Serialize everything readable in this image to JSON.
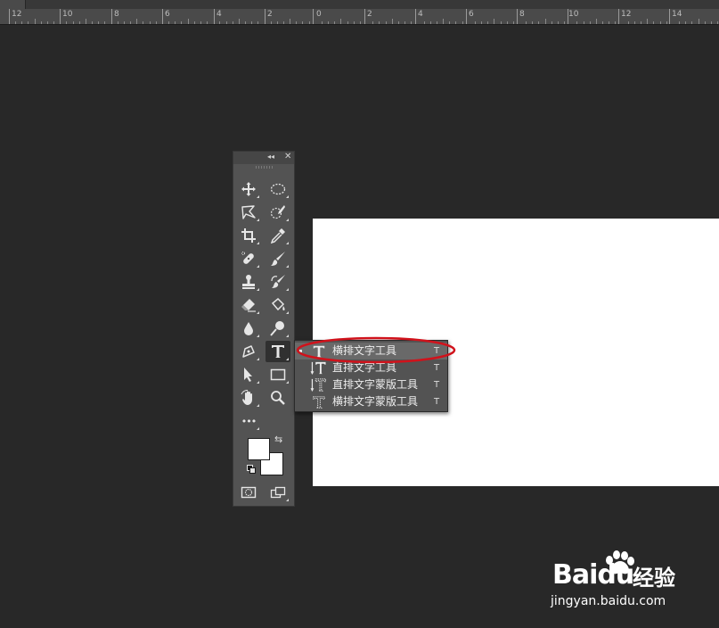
{
  "ruler": {
    "labels": [
      "12",
      "10",
      "8",
      "6",
      "4",
      "2",
      "0",
      "2",
      "4",
      "6",
      "8",
      "10",
      "12",
      "14"
    ]
  },
  "toolbar": {
    "collapse_glyph": "◂◂",
    "close_glyph": "✕",
    "tools": [
      {
        "name": "move-tool",
        "icon": "move-icon"
      },
      {
        "name": "elliptical-marquee-tool",
        "icon": "ellipse-marquee-icon"
      },
      {
        "name": "polygonal-lasso-tool",
        "icon": "lasso-icon"
      },
      {
        "name": "quick-selection-tool",
        "icon": "quick-select-icon"
      },
      {
        "name": "crop-tool",
        "icon": "crop-icon"
      },
      {
        "name": "eyedropper-tool",
        "icon": "eyedropper-icon"
      },
      {
        "name": "spot-healing-tool",
        "icon": "bandage-icon"
      },
      {
        "name": "brush-tool",
        "icon": "brush-icon"
      },
      {
        "name": "clone-stamp-tool",
        "icon": "stamp-icon"
      },
      {
        "name": "history-brush-tool",
        "icon": "history-brush-icon"
      },
      {
        "name": "eraser-tool",
        "icon": "eraser-icon"
      },
      {
        "name": "paint-bucket-tool",
        "icon": "bucket-icon"
      },
      {
        "name": "blur-tool",
        "icon": "drop-icon"
      },
      {
        "name": "dodge-tool",
        "icon": "dodge-icon"
      },
      {
        "name": "pen-tool",
        "icon": "pen-icon"
      },
      {
        "name": "type-tool",
        "icon": "type-icon"
      },
      {
        "name": "path-selection-tool",
        "icon": "arrow-icon"
      },
      {
        "name": "rectangle-tool",
        "icon": "rectangle-icon"
      },
      {
        "name": "rotate-view-tool",
        "icon": "hand-icon"
      },
      {
        "name": "zoom-tool",
        "icon": "zoom-icon"
      }
    ],
    "more_glyph": "•••",
    "swap_glyph": "⇆",
    "foreground_color": "#ffffff",
    "background_color": "#ffffff"
  },
  "type_flyout": {
    "items": [
      {
        "label": "横排文字工具",
        "shortcut": "T",
        "icon": "horizontal-type-icon",
        "selected": true
      },
      {
        "label": "直排文字工具",
        "shortcut": "T",
        "icon": "vertical-type-icon",
        "selected": false
      },
      {
        "label": "直排文字蒙版工具",
        "shortcut": "T",
        "icon": "vertical-type-mask-icon",
        "selected": false
      },
      {
        "label": "横排文字蒙版工具",
        "shortcut": "T",
        "icon": "horizontal-type-mask-icon",
        "selected": false
      }
    ]
  },
  "highlight_color": "#d0121b",
  "watermark": {
    "brand": "Baidu",
    "brand_cn": "经验",
    "url": "jingyan.baidu.com"
  }
}
